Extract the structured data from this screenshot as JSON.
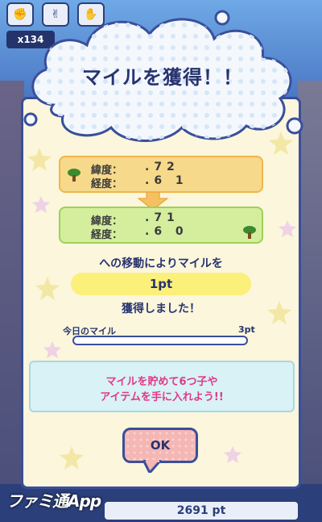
{
  "hud": {
    "counter": "x134",
    "hand_buttons": [
      "rock",
      "scissors",
      "paper"
    ]
  },
  "dialog": {
    "title": "マイルを獲得！！",
    "from": {
      "lat_label": "緯度：",
      "lat_value": ".72",
      "lon_label": "経度：",
      "lon_value": ".6 1"
    },
    "to": {
      "lat_label": "緯度：",
      "lat_value": ".71",
      "lon_label": "経度：",
      "lon_value": ".6 0"
    },
    "move_text": "への移動によりマイルを",
    "points": "1pt",
    "earned_text": "獲得しました！",
    "mile_label": "今日のマイル",
    "mile_max": "3pt",
    "mile_progress": 0,
    "info_line1": "マイルを貯めて6つ子や",
    "info_line2": "アイテムを手に入れよう!!",
    "ok_label": "OK"
  },
  "footer": {
    "brand": "ファミ通App",
    "total_points": "2691 pt"
  },
  "colors": {
    "navy": "#27336e",
    "dialog_bg": "#fbf6dc",
    "from_box": "#f6d98a",
    "to_box": "#d4ee9e",
    "pink_text": "#e0398a",
    "ok_button": "#f4b7b4"
  }
}
